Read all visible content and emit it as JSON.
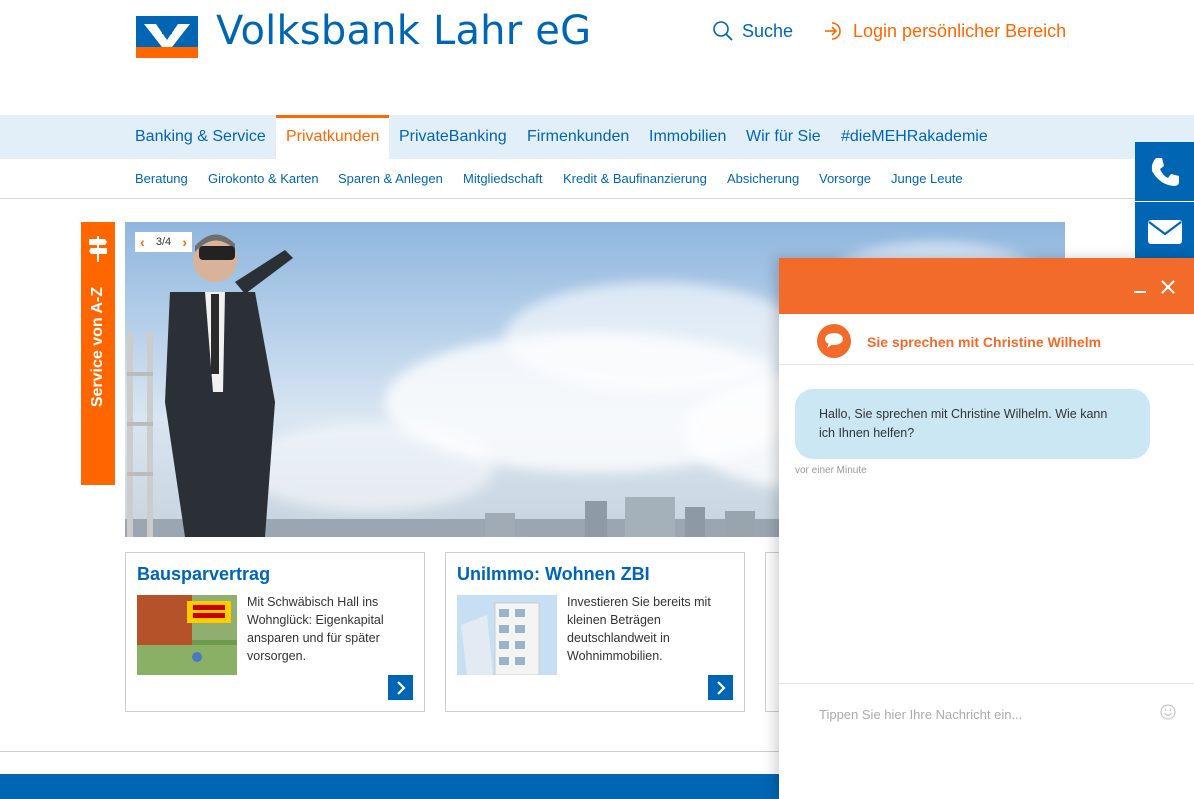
{
  "header": {
    "brand": "Volksbank Lahr eG",
    "search_label": "Suche",
    "login_label": "Login persönlicher Bereich"
  },
  "mainnav": {
    "items": [
      {
        "label": "Banking & Service"
      },
      {
        "label": "Privatkunden",
        "active": true
      },
      {
        "label": "PrivateBanking"
      },
      {
        "label": "Firmenkunden"
      },
      {
        "label": "Immobilien"
      },
      {
        "label": "Wir für Sie"
      },
      {
        "label": "#dieMEHRakademie"
      }
    ]
  },
  "subnav": {
    "items": [
      {
        "label": "Beratung"
      },
      {
        "label": "Girokonto & Karten"
      },
      {
        "label": "Sparen & Anlegen"
      },
      {
        "label": "Mitgliedschaft"
      },
      {
        "label": "Kredit & Baufinanzierung"
      },
      {
        "label": "Absicherung"
      },
      {
        "label": "Vorsorge"
      },
      {
        "label": "Junge Leute"
      }
    ]
  },
  "az_tab": {
    "label": "Service von A-Z"
  },
  "hero": {
    "pager": "3/4"
  },
  "cards": [
    {
      "title": "Bausparvertrag",
      "text": "Mit Schwäbisch Hall ins Wohnglück: Eigenkapital ansparen und für später vorsorgen."
    },
    {
      "title": "UniImmo: Wohnen ZBI",
      "text": "Investieren Sie bereits mit kleinen Beträgen deutschlandweit in Wohnimmobilien."
    }
  ],
  "chat": {
    "agent_title": "Sie sprechen mit Christine Wilhelm",
    "message": "Hallo, Sie sprechen mit Christine Wilhelm. Wie kann ich Ihnen helfen?",
    "message_time": "vor einer Minute",
    "input_placeholder": "Tippen Sie hier Ihre Nachricht ein..."
  },
  "colors": {
    "brand_blue": "#0066b3",
    "brand_orange": "#ff6600",
    "chat_orange": "#f26b2a",
    "nav_bg": "#e2eef8",
    "bubble_bg": "#cbe7f3"
  },
  "icons": [
    "search-icon",
    "login-icon",
    "signpost-icon",
    "phone-icon",
    "mail-icon",
    "minimize-icon",
    "close-icon",
    "chevron-left-icon",
    "chevron-right-icon",
    "emoji-icon"
  ]
}
